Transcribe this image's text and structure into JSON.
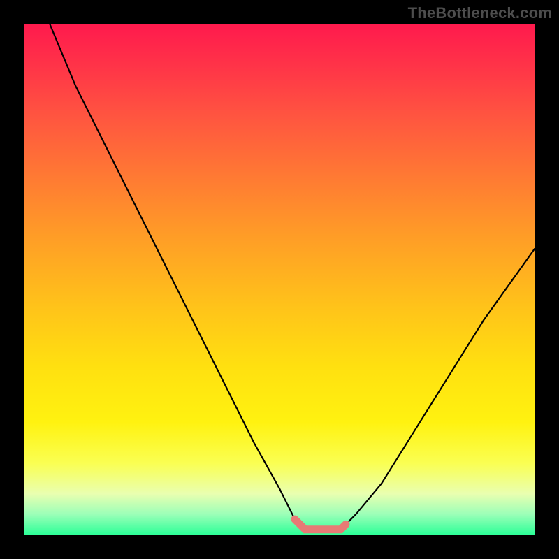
{
  "watermark": "TheBottleneck.com",
  "chart_data": {
    "type": "line",
    "title": "",
    "xlabel": "",
    "ylabel": "",
    "xlim": [
      0,
      100
    ],
    "ylim": [
      0,
      100
    ],
    "series": [
      {
        "name": "bottleneck-curve",
        "x": [
          5,
          10,
          15,
          20,
          25,
          30,
          35,
          40,
          45,
          50,
          53,
          55,
          60,
          63,
          65,
          70,
          75,
          80,
          85,
          90,
          95,
          100
        ],
        "y": [
          100,
          88,
          78,
          68,
          58,
          48,
          38,
          28,
          18,
          9,
          3,
          1,
          1,
          2,
          4,
          10,
          18,
          26,
          34,
          42,
          49,
          56
        ]
      },
      {
        "name": "optimal-region",
        "x": [
          53,
          55,
          58,
          60,
          62,
          63
        ],
        "y": [
          3,
          1,
          1,
          1,
          1,
          2
        ]
      }
    ],
    "colors": {
      "curve": "#000000",
      "optimal": "#e77a75"
    }
  }
}
